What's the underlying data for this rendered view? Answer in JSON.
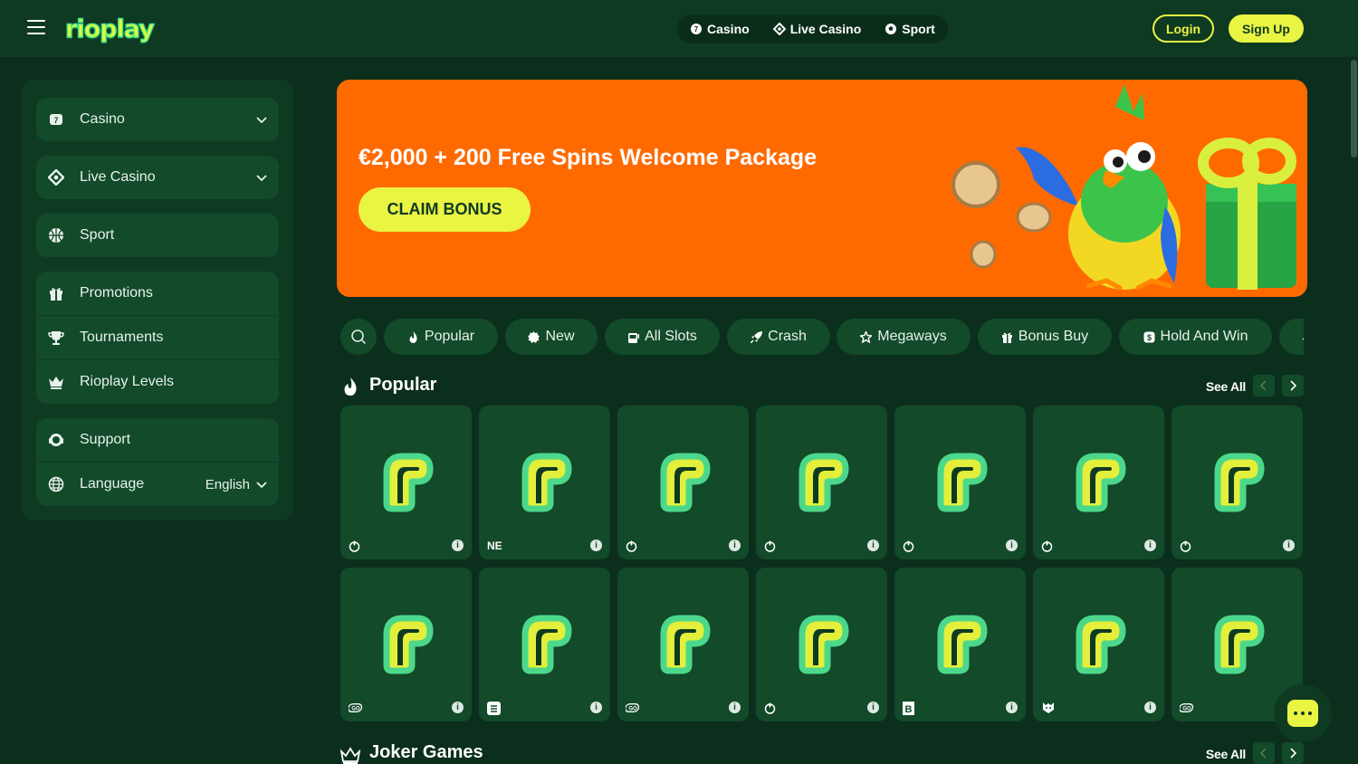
{
  "header": {
    "logo_text": "rioplay",
    "nav": [
      {
        "label": "Casino",
        "icon": "casino-icon"
      },
      {
        "label": "Live Casino",
        "icon": "live-casino-icon"
      },
      {
        "label": "Sport",
        "icon": "soccer-ball-icon"
      }
    ],
    "login_label": "Login",
    "signup_label": "Sign Up"
  },
  "sidebar": {
    "groups": [
      [
        {
          "label": "Casino",
          "icon": "casino-icon",
          "expandable": true
        }
      ],
      [
        {
          "label": "Live Casino",
          "icon": "live-casino-icon",
          "expandable": true
        }
      ],
      [
        {
          "label": "Sport",
          "icon": "sport-icon"
        }
      ],
      [
        {
          "label": "Promotions",
          "icon": "gift-icon"
        },
        {
          "label": "Tournaments",
          "icon": "trophy-icon"
        },
        {
          "label": "Rioplay Levels",
          "icon": "crown-icon"
        }
      ],
      [
        {
          "label": "Support",
          "icon": "headset-icon"
        },
        {
          "label": "Language",
          "icon": "globe-icon",
          "value": "English"
        }
      ]
    ]
  },
  "banner": {
    "title": "€2,000 + 200 Free Spins Welcome Package",
    "cta_label": "CLAIM BONUS"
  },
  "categories": [
    {
      "label": "Popular",
      "icon": "flame-icon"
    },
    {
      "label": "New",
      "icon": "new-badge-icon"
    },
    {
      "label": "All Slots",
      "icon": "slot-machine-icon"
    },
    {
      "label": "Crash",
      "icon": "rocket-icon"
    },
    {
      "label": "Megaways",
      "icon": "star-icon"
    },
    {
      "label": "Bonus Buy",
      "icon": "gift-icon"
    },
    {
      "label": "Hold And Win",
      "icon": "dollar-icon"
    }
  ],
  "sections": [
    {
      "title": "Popular",
      "icon": "flame-icon",
      "see_all_label": "See All",
      "games": [
        {
          "provider": "flame-badge"
        },
        {
          "provider": "NE"
        },
        {
          "provider": "flame-badge"
        },
        {
          "provider": "flame-badge"
        },
        {
          "provider": "flame-badge"
        },
        {
          "provider": "flame-badge"
        },
        {
          "provider": "flame-badge"
        },
        {
          "provider": "GO"
        },
        {
          "provider": "S"
        },
        {
          "provider": "GO"
        },
        {
          "provider": "flame-badge"
        },
        {
          "provider": "B"
        },
        {
          "provider": "tiger-badge"
        },
        {
          "provider": "GO"
        }
      ]
    },
    {
      "title": "Joker Games",
      "icon": "crown-icon",
      "see_all_label": "See All"
    }
  ],
  "colors": {
    "page_bg": "#0b2f1c",
    "panel_bg": "#0f3a22",
    "item_bg": "#124a2a",
    "accent_yellow": "#eaf443",
    "banner_orange": "#ff6a00",
    "logo_green": "#3ee08a"
  }
}
